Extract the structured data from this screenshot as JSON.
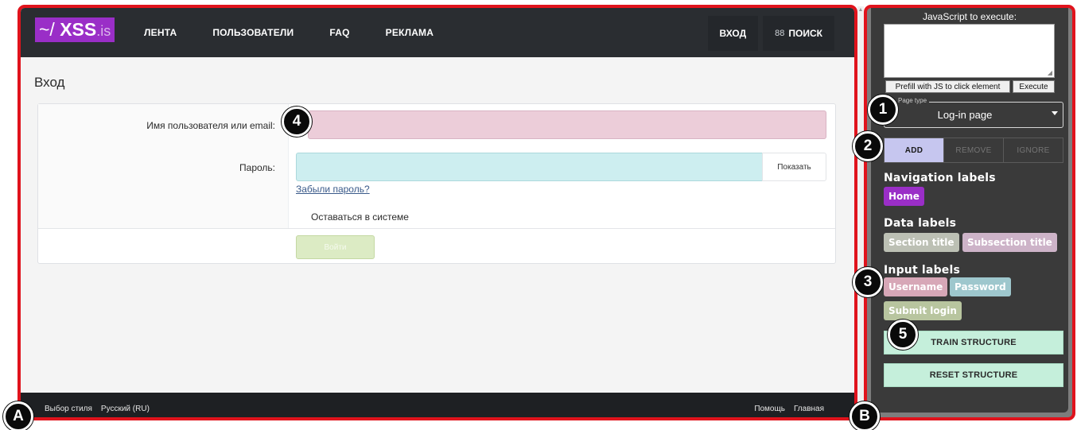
{
  "site": {
    "logo": {
      "prefix": "~/",
      "name": "XSS",
      "tld": ".is"
    },
    "nav": [
      {
        "label": "ЛЕНТА"
      },
      {
        "label": "ПОЛЬЗОВАТЕЛИ"
      },
      {
        "label": "FAQ"
      },
      {
        "label": "РЕКЛАМА"
      }
    ],
    "nav_right": {
      "login_label": "ВХОД",
      "search_icon": "grid-icon",
      "search_glyph": "88",
      "search_label": "ПОИСК"
    },
    "page_title": "Вход",
    "form": {
      "username_label": "Имя пользователя или email:",
      "password_label": "Пароль:",
      "show_label": "Показать",
      "forgot_label": "Забыли пароль?",
      "stay_label": "Оставаться в системе",
      "submit_label": "Войти"
    },
    "footer": {
      "style_label": "Выбор стиля",
      "lang_label": "Русский (RU)",
      "help_label": "Помощь",
      "home_label": "Главная"
    },
    "colors": {
      "nav_bg": "#2a2d31",
      "logo_bg": "#9a2ec7",
      "username_fill": "#eccdd9",
      "password_fill": "#cdeef0",
      "submit_fill": "#dcebc4"
    }
  },
  "panel": {
    "js_title": "JavaScript to execute:",
    "js_value": "",
    "prefill_label": "Prefill with JS to click element",
    "execute_label": "Execute",
    "page_type_legend": "Page type",
    "page_type_value": "Log-in page",
    "modes": [
      {
        "label": "ADD",
        "active": true
      },
      {
        "label": "REMOVE",
        "active": false
      },
      {
        "label": "IGNORE",
        "active": false
      }
    ],
    "nav_labels_title": "Navigation labels",
    "nav_labels": [
      {
        "label": "Home",
        "color": "#9a2ec7"
      }
    ],
    "data_labels_title": "Data labels",
    "data_labels": [
      {
        "label": "Section title",
        "color": "#bcc0b4"
      },
      {
        "label": "Subsection title",
        "color": "#cdb3c8"
      }
    ],
    "input_labels_title": "Input labels",
    "input_labels": [
      {
        "label": "Username",
        "color": "#d7a7b7"
      },
      {
        "label": "Password",
        "color": "#9ec7cd"
      },
      {
        "label": "Submit login",
        "color": "#b8c59f"
      }
    ],
    "train_label": "TRAIN STRUCTURE",
    "reset_label": "RESET STRUCTURE"
  },
  "markers": {
    "m1": "1",
    "m2": "2",
    "m3": "3",
    "m4": "4",
    "m5": "5",
    "mA": "A",
    "mB": "B"
  }
}
